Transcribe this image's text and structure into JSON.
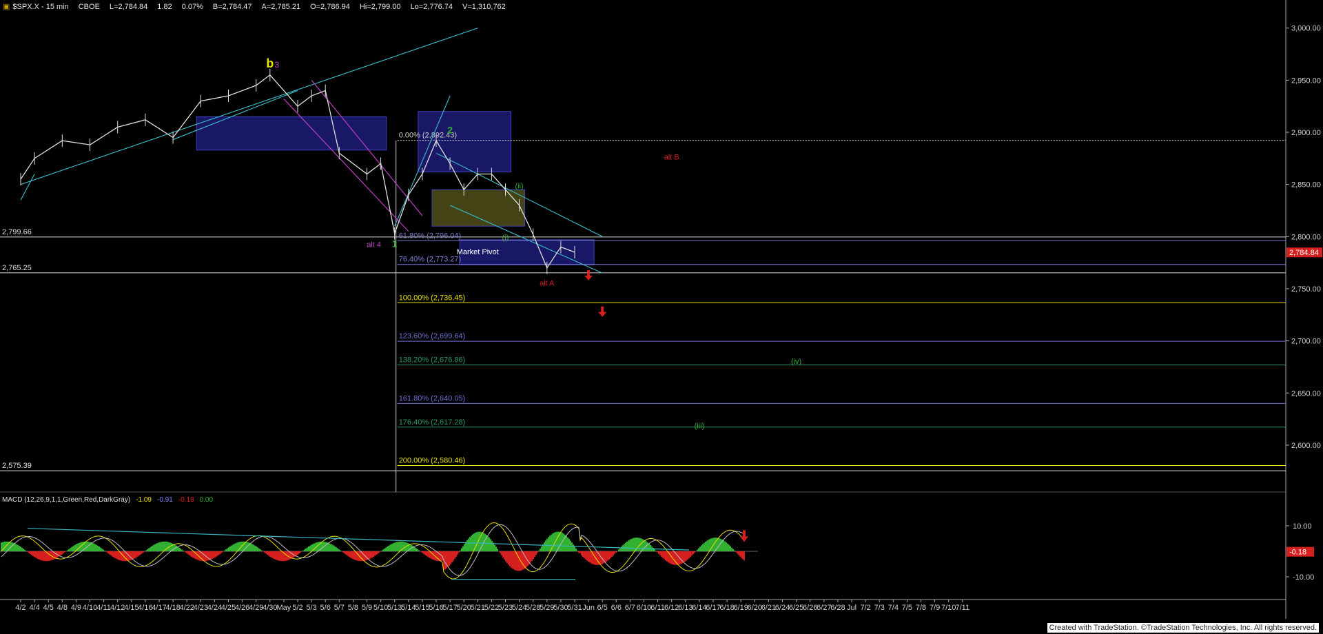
{
  "header": {
    "symbol": "$SPX.X - 15 min",
    "exchange": "CBOE",
    "last": "L=2,784.84",
    "change": "1.82",
    "change_pct": "0.07%",
    "bid": "B=2,784.47",
    "ask": "A=2,785.21",
    "open": "O=2,786.94",
    "high": "Hi=2,799.00",
    "low": "Lo=2,776.74",
    "volume": "V=1,310,762"
  },
  "macd": {
    "label": "MACD (12,26,9,1,1,Green,Red,DarkGray)",
    "v1": "-1.09",
    "v2": "-0.91",
    "v3": "-0.18",
    "v4": "0.00",
    "tick_labels": [
      "10.00",
      "-10.00"
    ],
    "last_label": "-0.18"
  },
  "footer": "Created with TradeStation. ©TradeStation Technologies, Inc. All rights reserved.",
  "colors": {
    "background": "#000000",
    "price_bar": "#e0e0e0",
    "trendline": "#3ab5c0",
    "box": "#1c1c78",
    "box_yellow": "#4f4f1a",
    "red": "#d62020",
    "green": "#31b031",
    "yellow": "#e8e000",
    "magenta": "#c040c0",
    "slate": "#8080d0"
  },
  "chart_data": {
    "type": "line",
    "y_axis": {
      "ticks": [
        "3,000.00",
        "2,950.00",
        "2,900.00",
        "2,850.00",
        "2,800.00",
        "2,750.00",
        "2,700.00",
        "2,650.00",
        "2,600.00"
      ],
      "tick_values": [
        3000,
        2950,
        2900,
        2850,
        2800,
        2750,
        2700,
        2650,
        2600
      ],
      "range": [
        2555,
        3015
      ],
      "last_price_label": "2,784.84",
      "last_price": 2784.84
    },
    "x_axis": {
      "labels": [
        "4/2",
        "4/4",
        "4/5",
        "4/8",
        "4/9",
        "4/10",
        "4/11",
        "4/12",
        "4/15",
        "4/16",
        "4/17",
        "4/18",
        "4/22",
        "4/23",
        "4/24",
        "4/25",
        "4/26",
        "4/29",
        "4/30",
        "May",
        "5/2",
        "5/3",
        "5/6",
        "5/7",
        "5/8",
        "5/9",
        "5/10",
        "5/13",
        "5/14",
        "5/15",
        "5/16",
        "5/17",
        "5/20",
        "5/21",
        "5/22",
        "5/23",
        "5/24",
        "5/28",
        "5/29",
        "5/30",
        "5/31",
        "Jun",
        "6/5",
        "6/6",
        "6/7",
        "6/10",
        "6/11",
        "6/12",
        "6/13",
        "6/14",
        "6/17",
        "6/18",
        "6/19",
        "6/20",
        "6/21",
        "6/24",
        "6/25",
        "6/26",
        "6/27",
        "6/28",
        "Jul",
        "7/2",
        "7/3",
        "7/4",
        "7/5",
        "7/8",
        "7/9",
        "7/10",
        "7/11"
      ]
    },
    "price_series": {
      "dates": [
        "4/2",
        "4/4",
        "4/8",
        "4/10",
        "4/12",
        "4/16",
        "4/18",
        "4/23",
        "4/25",
        "4/29",
        "4/30",
        "5/2",
        "5/3",
        "5/6",
        "5/7",
        "5/9",
        "5/10",
        "5/13",
        "5/14",
        "5/15",
        "5/16",
        "5/17",
        "5/20",
        "5/21",
        "5/22",
        "5/23",
        "5/24",
        "5/28",
        "5/29",
        "5/30",
        "5/31"
      ],
      "close": [
        2855,
        2875,
        2892,
        2888,
        2905,
        2912,
        2895,
        2930,
        2935,
        2945,
        2955,
        2925,
        2935,
        2940,
        2880,
        2860,
        2870,
        2803,
        2840,
        2860,
        2892,
        2870,
        2845,
        2860,
        2860,
        2845,
        2830,
        2802,
        2770,
        2790,
        2785
      ]
    },
    "horizontal_levels": [
      {
        "label": "2,799.66",
        "value": 2799.66
      },
      {
        "label": "2,765.25",
        "value": 2765.25
      },
      {
        "label": "2,575.39",
        "value": 2575.39
      }
    ],
    "fibonacci": [
      {
        "label": "0.00% (2,892.43)",
        "value": 2892.43
      },
      {
        "label": "61.80% (2,796.04)",
        "value": 2796.04
      },
      {
        "label": "76.40% (2,773.27)",
        "value": 2773.27
      },
      {
        "label": "100.00% (2,736.45)",
        "value": 2736.45
      },
      {
        "label": "123.60% (2,699.64)",
        "value": 2699.64
      },
      {
        "label": "138.20% (2,676.86)",
        "value": 2676.86
      },
      {
        "label": "161.80% (2,640.05)",
        "value": 2640.05
      },
      {
        "label": "176.40% (2,617.28)",
        "value": 2617.28
      },
      {
        "label": "200.00% (2,580.46)",
        "value": 2580.46
      }
    ],
    "annotations": [
      {
        "text": "b",
        "date": "4/30",
        "value": 2962
      },
      {
        "text": "3",
        "date": "4/30",
        "value": 2962
      },
      {
        "text": "2",
        "date": "5/17",
        "value": 2899
      },
      {
        "text": "1",
        "date": "5/13",
        "value": 2790
      },
      {
        "text": "alt 4",
        "date": "5/10",
        "value": 2790
      },
      {
        "text": "alt B",
        "date": "6/12",
        "value": 2874
      },
      {
        "text": "alt A",
        "date": "5/29",
        "value": 2753
      },
      {
        "text": "Market Pivot",
        "date": "5/21",
        "value": 2783
      },
      {
        "text": "(i)",
        "date": "5/23",
        "value": 2797
      },
      {
        "text": "(ii)",
        "date": "5/24",
        "value": 2846
      },
      {
        "text": "(iii)",
        "date": "6/14",
        "value": 2616
      },
      {
        "text": "(iv)",
        "date": "6/25",
        "value": 2678
      }
    ]
  }
}
